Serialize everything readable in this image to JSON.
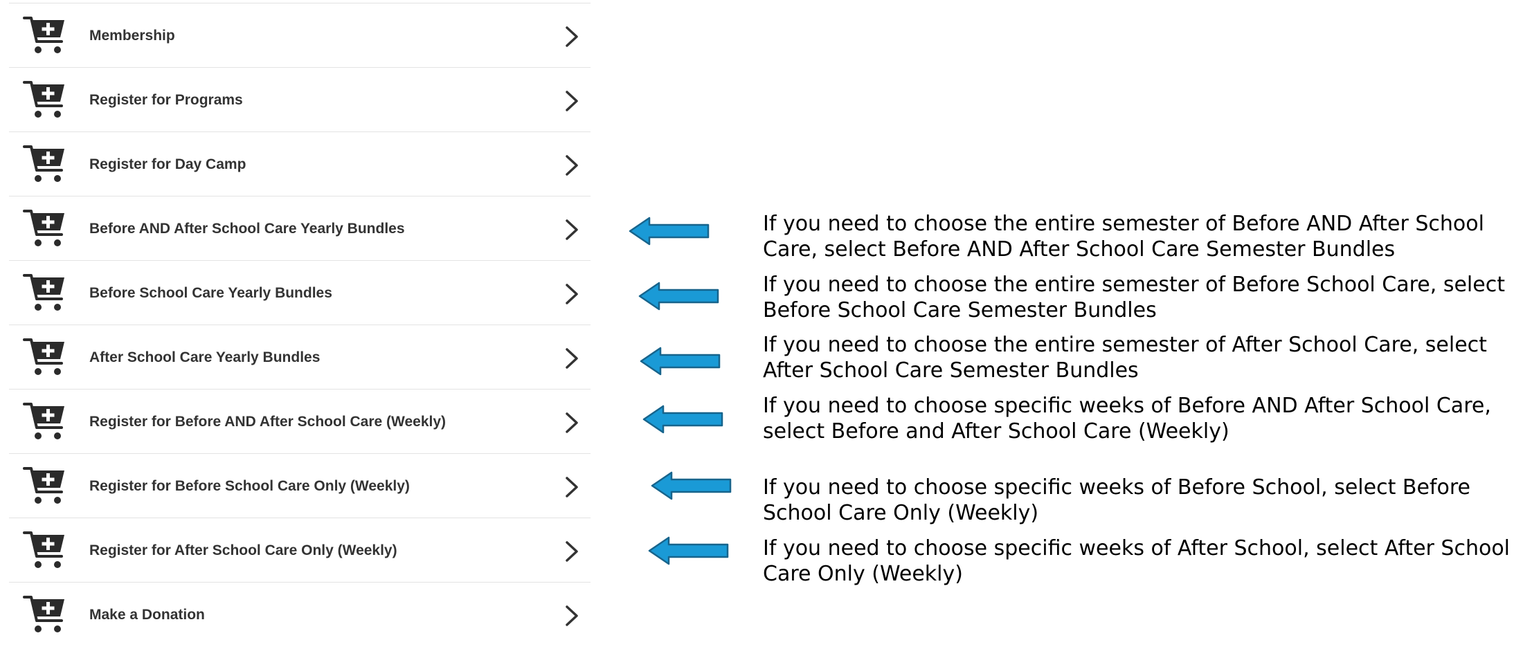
{
  "menu": {
    "items": [
      {
        "label": "Membership"
      },
      {
        "label": "Register for Programs"
      },
      {
        "label": "Register for Day Camp"
      },
      {
        "label": "Before AND After School Care Yearly Bundles"
      },
      {
        "label": "Before School Care Yearly Bundles"
      },
      {
        "label": "After School Care Yearly Bundles"
      },
      {
        "label": "Register for Before AND After School Care (Weekly)"
      },
      {
        "label": "Register for Before School Care Only (Weekly)"
      },
      {
        "label": "Register for After School Care Only (Weekly)"
      },
      {
        "label": "Make a Donation"
      }
    ],
    "item_icon": "cart-add-icon",
    "chevron_icon": "chevron-right-icon"
  },
  "annotations": {
    "arrow_icon": "left-arrow-icon",
    "arrow_color": "#1a9ad6",
    "notes": [
      "If you need to choose the entire semester of Before AND After School Care, select Before AND After School Care Semester Bundles",
      "If you need to choose the entire semester of Before School Care, select Before School Care Semester Bundles",
      "If you need to choose the entire semester of After School Care, select After School Care Semester Bundles",
      "If you need to choose specific weeks of Before AND After School Care, select Before and After School Care (Weekly)",
      "If you need to choose specific weeks of Before School, select Before School Care Only (Weekly)",
      "If you need to choose specific weeks of After School, select After School Care Only (Weekly)"
    ]
  },
  "colors": {
    "icon": "#2b2b2b",
    "label": "#333333",
    "divider": "#e3e3e3"
  }
}
